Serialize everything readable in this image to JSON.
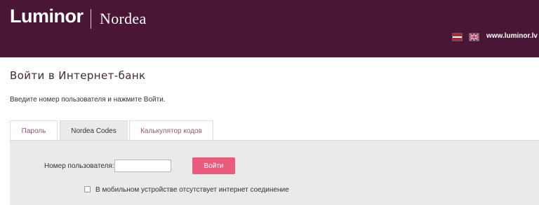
{
  "header": {
    "brand_primary": "Luminor",
    "brand_secondary": "Nordea",
    "background_color": "#4a1635",
    "languages": [
      {
        "code": "lv",
        "icon": "latvia-flag-icon"
      },
      {
        "code": "en",
        "icon": "uk-flag-icon"
      }
    ],
    "site_link": "www.luminor.lv"
  },
  "main": {
    "title": "Войти в Интернет-банк",
    "instruction": "Введите номер пользователя и нажмите Войти.",
    "tabs": [
      {
        "label": "Пароль",
        "active": false
      },
      {
        "label": "Nordea Codes",
        "active": true
      },
      {
        "label": "Калькулятор кодов",
        "active": false
      }
    ],
    "form": {
      "username_label": "Номер пользователя:",
      "username_value": "",
      "submit_label": "Войти",
      "submit_color": "#ea5a7c",
      "offline_checkbox_label": "В мобильном устройстве отсутствует интернет соединение",
      "offline_checked": false
    }
  }
}
